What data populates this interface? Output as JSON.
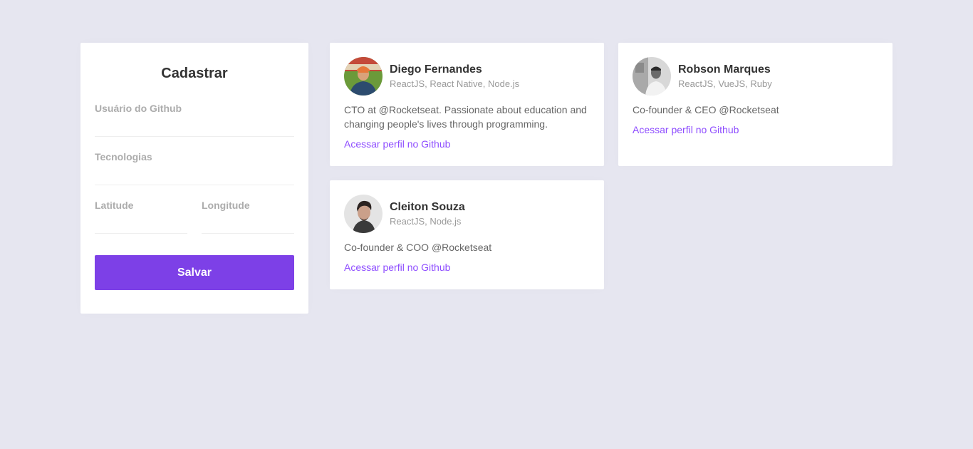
{
  "form": {
    "title": "Cadastrar",
    "github_username": {
      "label": "Usuário do Github",
      "value": ""
    },
    "techs": {
      "label": "Tecnologias",
      "value": ""
    },
    "latitude": {
      "label": "Latitude",
      "value": ""
    },
    "longitude": {
      "label": "Longitude",
      "value": ""
    },
    "submit_label": "Salvar"
  },
  "devs": [
    {
      "name": "Diego Fernandes",
      "techs": "ReactJS, React Native, Node.js",
      "bio": "CTO at @Rocketseat. Passionate about education and changing people's lives through programming.",
      "link_label": "Acessar perfil no Github"
    },
    {
      "name": "Robson Marques",
      "techs": "ReactJS, VueJS, Ruby",
      "bio": "Co-founder & CEO @Rocketseat",
      "link_label": "Acessar perfil no Github"
    },
    {
      "name": "Cleiton Souza",
      "techs": "ReactJS, Node.js",
      "bio": "Co-founder & COO @Rocketseat",
      "link_label": "Acessar perfil no Github"
    }
  ],
  "colors": {
    "background": "#e6e6f0",
    "primary": "#7d40e7",
    "link": "#8e4dff"
  }
}
